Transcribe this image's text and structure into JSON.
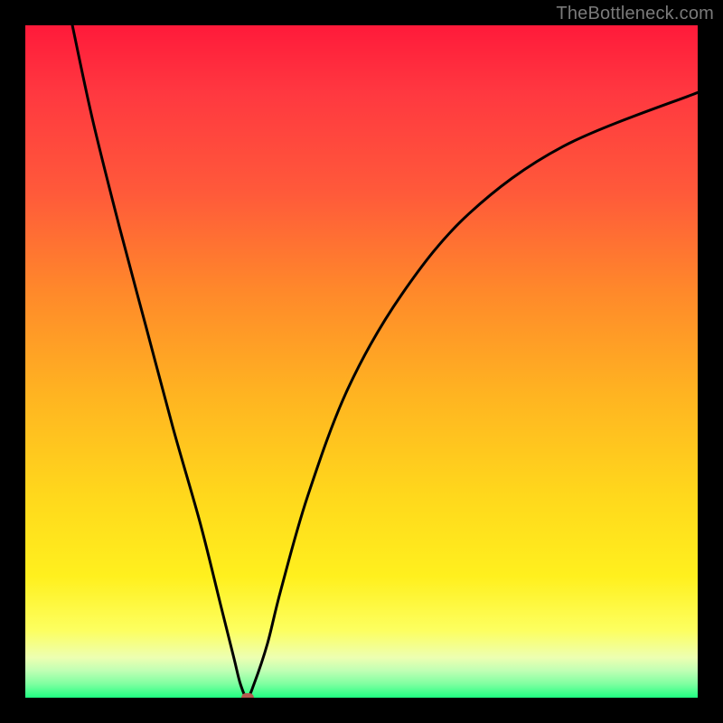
{
  "watermark": "TheBottleneck.com",
  "colors": {
    "frame": "#000000",
    "curve": "#000000",
    "marker": "#b65a50",
    "gradient_top": "#ff1a3a",
    "gradient_bottom": "#1fff82"
  },
  "chart_data": {
    "type": "line",
    "title": "",
    "xlabel": "",
    "ylabel": "",
    "xlim": [
      0,
      100
    ],
    "ylim": [
      0,
      100
    ],
    "grid": false,
    "legend": false,
    "marker": {
      "x": 33,
      "y": 0
    },
    "series": [
      {
        "name": "curve",
        "x": [
          7,
          10,
          14,
          18,
          22,
          26,
          29,
          31,
          32,
          33,
          34,
          36,
          38,
          42,
          48,
          56,
          66,
          80,
          100
        ],
        "values": [
          100,
          86,
          70,
          55,
          40,
          26,
          14,
          6,
          2,
          0,
          2,
          8,
          16,
          30,
          46,
          60,
          72,
          82,
          90
        ]
      }
    ]
  }
}
